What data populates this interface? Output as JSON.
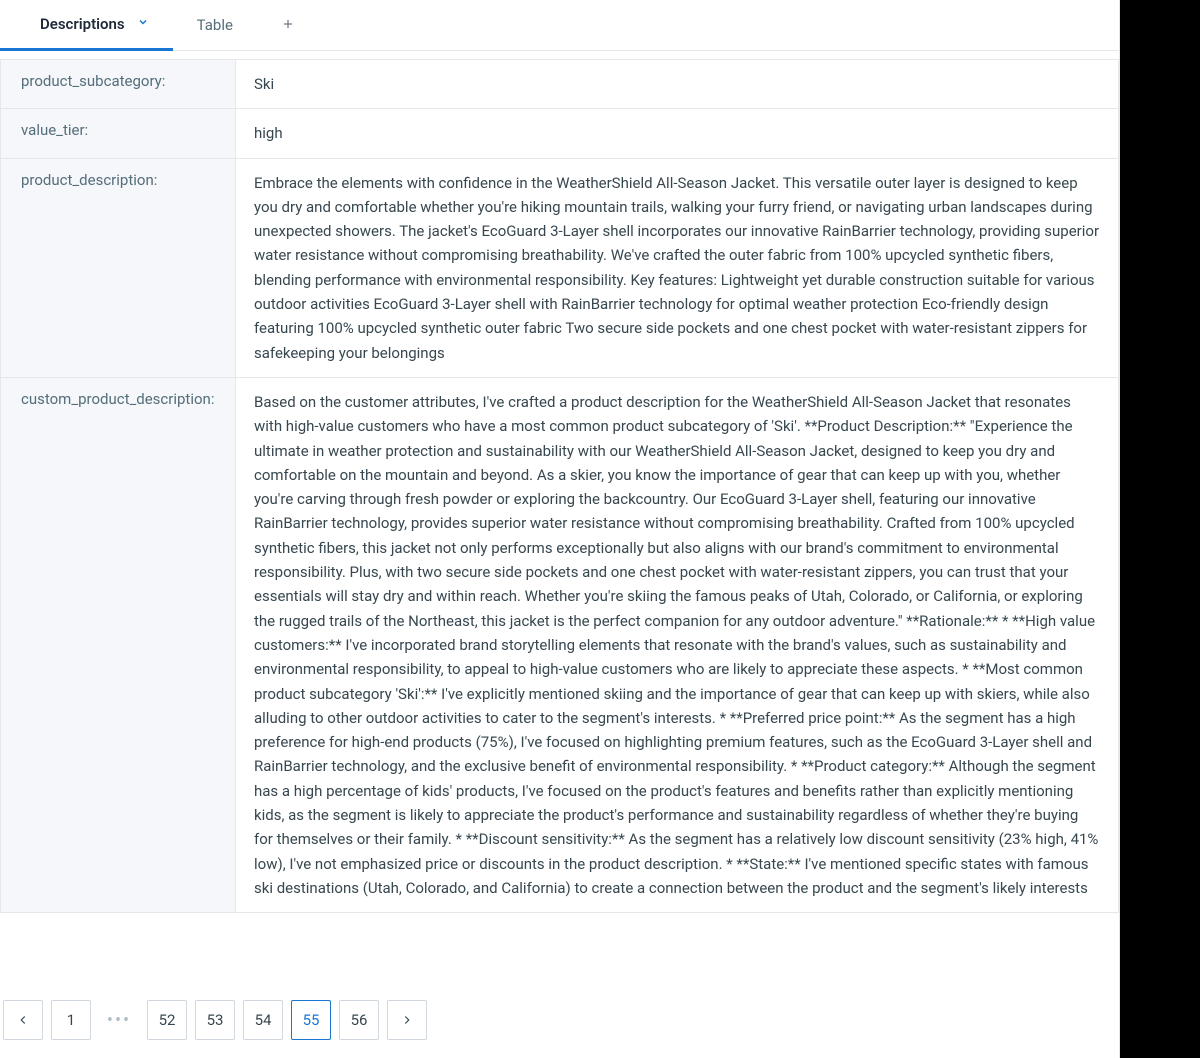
{
  "tabs": {
    "active": "Descriptions",
    "secondary": "Table"
  },
  "rows": [
    {
      "label": "product_subcategory:",
      "value": "Ski"
    },
    {
      "label": "value_tier:",
      "value": "high"
    },
    {
      "label": "product_description:",
      "value": "Embrace the elements with confidence in the WeatherShield All-Season Jacket. This versatile outer layer is designed to keep you dry and comfortable whether you're hiking mountain trails, walking your furry friend, or navigating urban landscapes during unexpected showers. The jacket's EcoGuard 3-Layer shell incorporates our innovative RainBarrier technology, providing superior water resistance without compromising breathability. We've crafted the outer fabric from 100% upcycled synthetic fibers, blending performance with environmental responsibility. Key features: Lightweight yet durable construction suitable for various outdoor activities EcoGuard 3-Layer shell with RainBarrier technology for optimal weather protection Eco-friendly design featuring 100% upcycled synthetic outer fabric Two secure side pockets and one chest pocket with water-resistant zippers for safekeeping your belongings"
    },
    {
      "label": "custom_product_description:",
      "value": "Based on the customer attributes, I've crafted a product description for the WeatherShield All-Season Jacket that resonates with high-value customers who have a most common product subcategory of 'Ski'. **Product Description:** \"Experience the ultimate in weather protection and sustainability with our WeatherShield All-Season Jacket, designed to keep you dry and comfortable on the mountain and beyond. As a skier, you know the importance of gear that can keep up with you, whether you're carving through fresh powder or exploring the backcountry. Our EcoGuard 3-Layer shell, featuring our innovative RainBarrier technology, provides superior water resistance without compromising breathability. Crafted from 100% upcycled synthetic fibers, this jacket not only performs exceptionally but also aligns with our brand's commitment to environmental responsibility. Plus, with two secure side pockets and one chest pocket with water-resistant zippers, you can trust that your essentials will stay dry and within reach. Whether you're skiing the famous peaks of Utah, Colorado, or California, or exploring the rugged trails of the Northeast, this jacket is the perfect companion for any outdoor adventure.\" **Rationale:** * **High value customers:** I've incorporated brand storytelling elements that resonate with the brand's values, such as sustainability and environmental responsibility, to appeal to high-value customers who are likely to appreciate these aspects. * **Most common product subcategory 'Ski':** I've explicitly mentioned skiing and the importance of gear that can keep up with skiers, while also alluding to other outdoor activities to cater to the segment's interests. * **Preferred price point:** As the segment has a high preference for high-end products (75%), I've focused on highlighting premium features, such as the EcoGuard 3-Layer shell and RainBarrier technology, and the exclusive benefit of environmental responsibility. * **Product category:** Although the segment has a high percentage of kids' products, I've focused on the product's features and benefits rather than explicitly mentioning kids, as the segment is likely to appreciate the product's performance and sustainability regardless of whether they're buying for themselves or their family. * **Discount sensitivity:** As the segment has a relatively low discount sensitivity (23% high, 41% low), I've not emphasized price or discounts in the product description. * **State:** I've mentioned specific states with famous ski destinations (Utah, Colorado, and California) to create a connection between the product and the segment's likely interests"
    }
  ],
  "pagination": {
    "pages": [
      "1",
      "52",
      "53",
      "54",
      "55",
      "56"
    ],
    "current": "55"
  }
}
